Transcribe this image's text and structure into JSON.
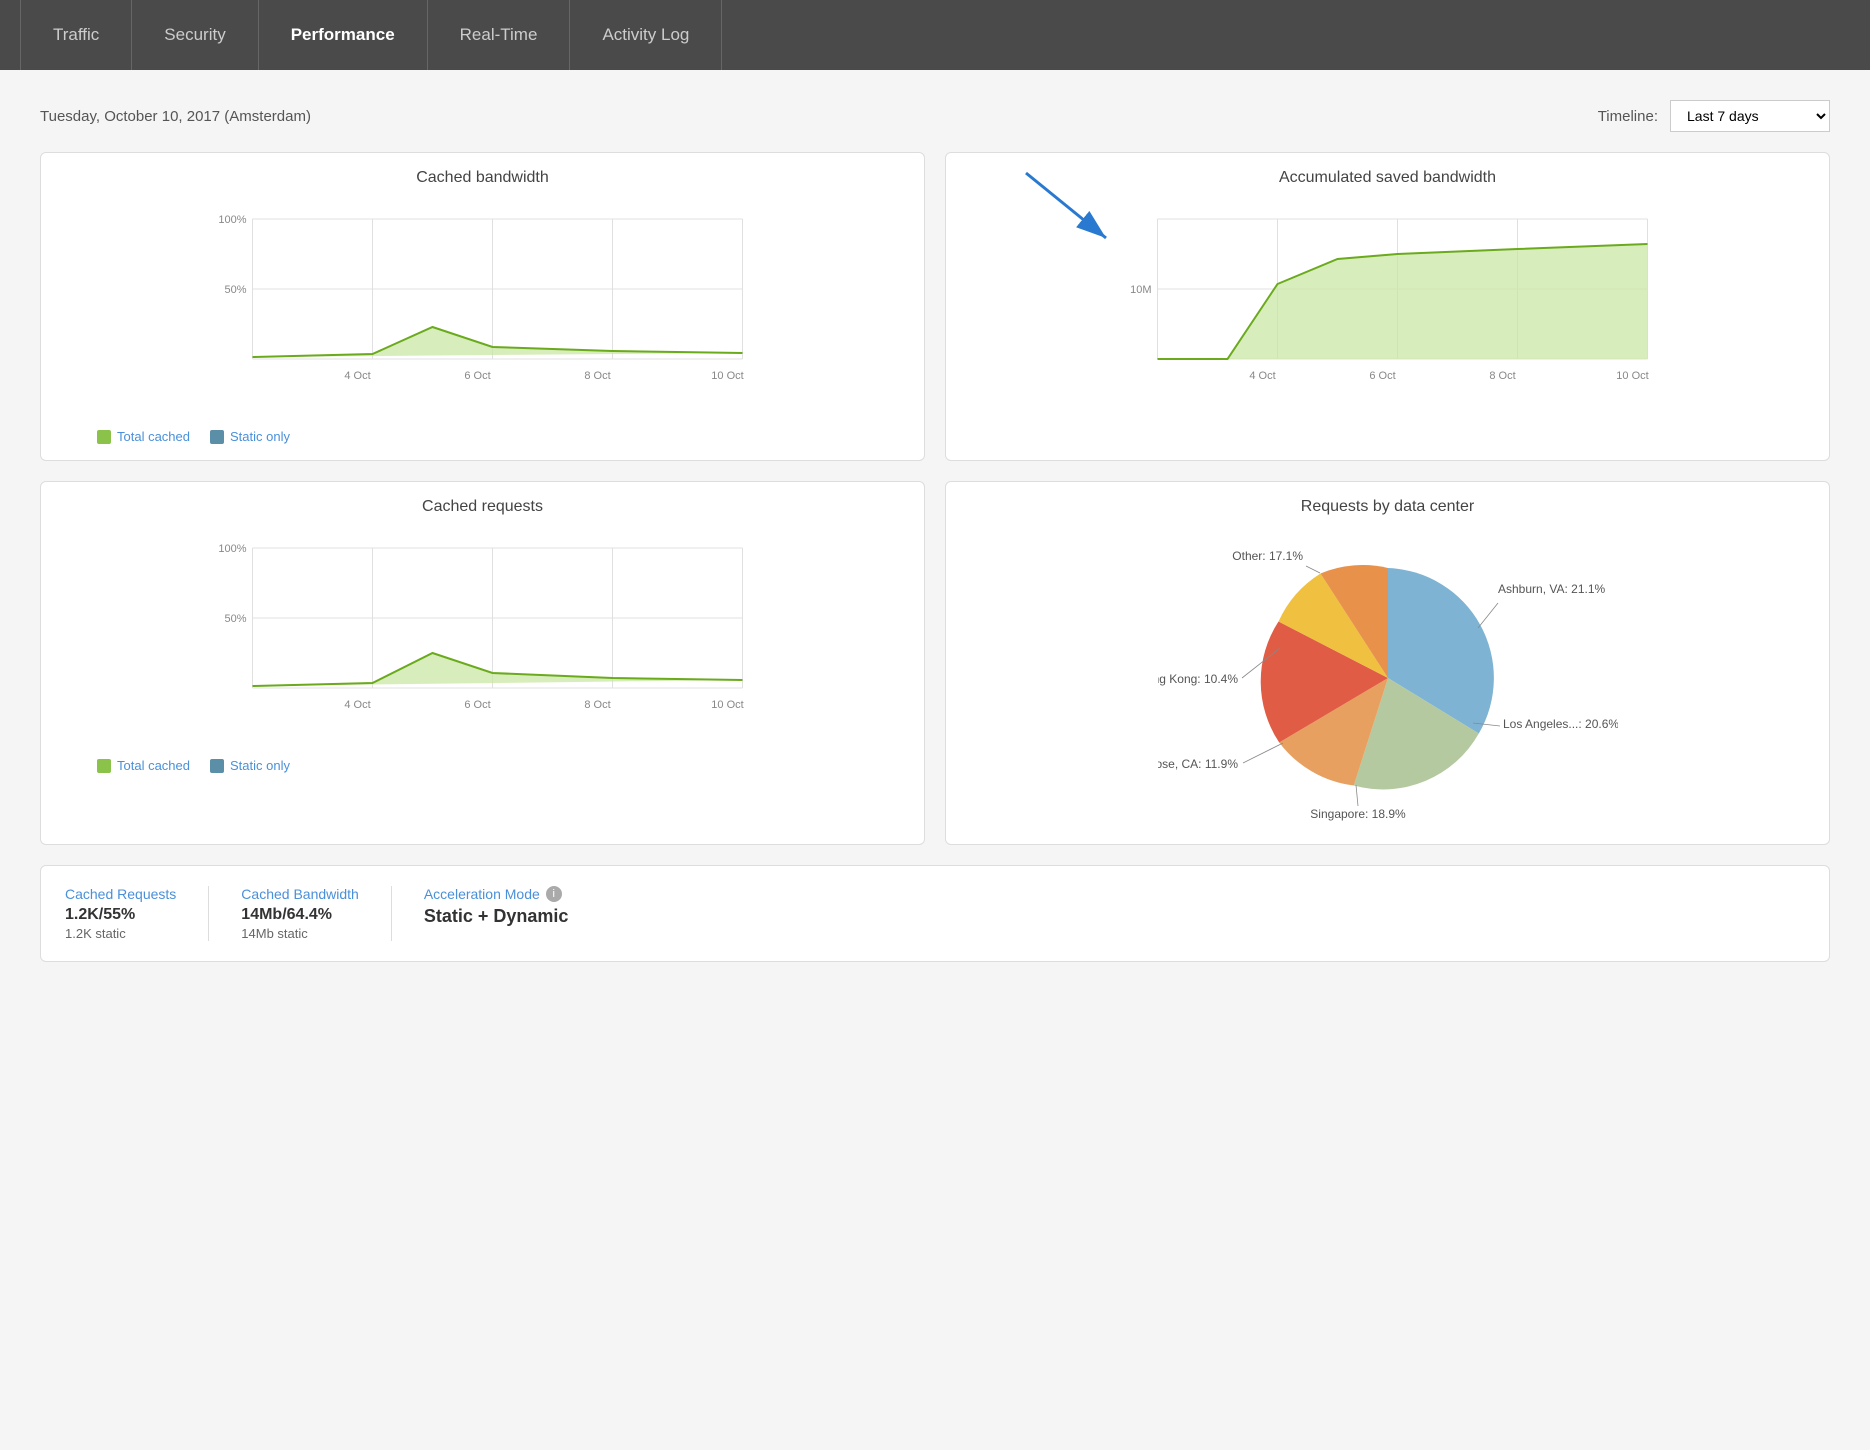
{
  "nav": {
    "items": [
      {
        "id": "traffic",
        "label": "Traffic",
        "active": false
      },
      {
        "id": "security",
        "label": "Security",
        "active": false
      },
      {
        "id": "performance",
        "label": "Performance",
        "active": true
      },
      {
        "id": "realtime",
        "label": "Real-Time",
        "active": false
      },
      {
        "id": "activitylog",
        "label": "Activity Log",
        "active": false
      }
    ]
  },
  "header": {
    "date": "Tuesday, October 10, 2017 (Amsterdam)",
    "timeline_label": "Timeline:",
    "timeline_value": "Last 7 days"
  },
  "charts": {
    "cached_bandwidth": {
      "title": "Cached bandwidth",
      "x_labels": [
        "4 Oct",
        "6 Oct",
        "8 Oct",
        "10 Oct"
      ],
      "y_labels": [
        "100%",
        "50%"
      ],
      "legend": {
        "total_cached": "Total cached",
        "static_only": "Static only"
      }
    },
    "accumulated_bandwidth": {
      "title": "Accumulated saved bandwidth",
      "x_labels": [
        "4 Oct",
        "6 Oct",
        "8 Oct",
        "10 Oct"
      ],
      "y_labels": [
        "10M"
      ],
      "arrow_text": ""
    },
    "cached_requests": {
      "title": "Cached requests",
      "x_labels": [
        "4 Oct",
        "6 Oct",
        "8 Oct",
        "10 Oct"
      ],
      "y_labels": [
        "100%",
        "50%"
      ],
      "legend": {
        "total_cached": "Total cached",
        "static_only": "Static only"
      }
    },
    "requests_datacenter": {
      "title": "Requests by data center",
      "segments": [
        {
          "label": "Ashburn, VA",
          "value": 21.1,
          "color": "#7eb3d4"
        },
        {
          "label": "Los Angeles...",
          "value": 20.6,
          "color": "#b5c9a0"
        },
        {
          "label": "Singapore",
          "value": 18.9,
          "color": "#e8a060"
        },
        {
          "label": "San Jose, CA",
          "value": 11.9,
          "color": "#e05c45"
        },
        {
          "label": "Hong Kong",
          "value": 10.4,
          "color": "#f0c040"
        },
        {
          "label": "Other",
          "value": 17.1,
          "color": "#e8914a"
        }
      ]
    }
  },
  "stats": {
    "cached_requests": {
      "title": "Cached Requests",
      "value": "1.2K/55%",
      "sub": "1.2K static"
    },
    "cached_bandwidth": {
      "title": "Cached Bandwidth",
      "value": "14Mb/64.4%",
      "sub": "14Mb static"
    },
    "acceleration_mode": {
      "title": "Acceleration Mode",
      "value": "Static + Dynamic"
    }
  }
}
